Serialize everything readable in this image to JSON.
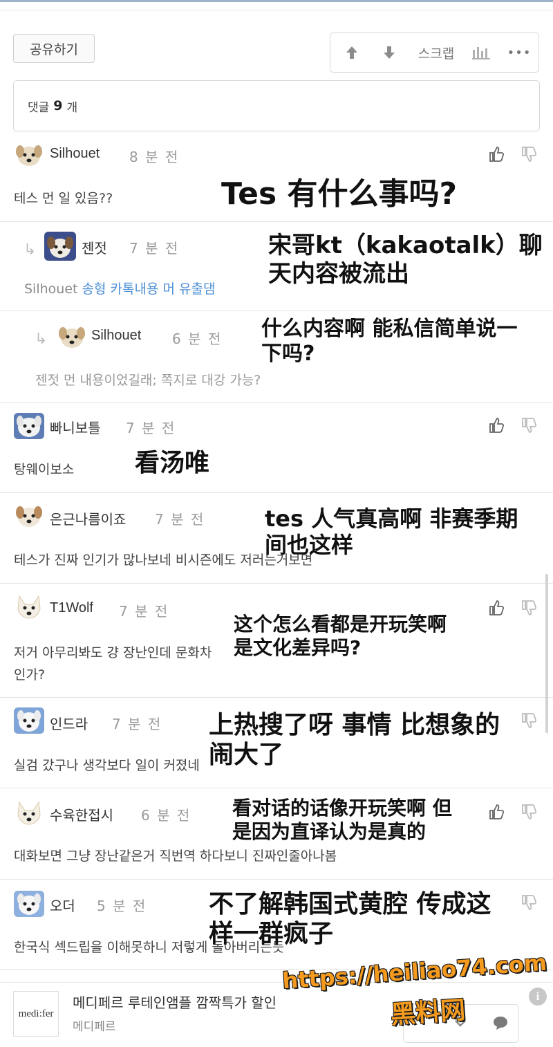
{
  "toolbar": {
    "share_label": "공유하기",
    "scrap_label": "스크랩",
    "more_label": "•••"
  },
  "comment_count": {
    "prefix": "댓글",
    "count": "9",
    "suffix": "개"
  },
  "comments": [
    {
      "author": "Silhouet",
      "time": "8 분 전",
      "text": "테스 먼 일 있음??",
      "overlay": "Tes 有什么事吗?"
    },
    {
      "author": "젠젓",
      "time": "7 분 전",
      "mention": "Silhouet",
      "text": "송형 카톡내용 머 유출댐",
      "overlay": "宋哥kt（kakaotalk）聊天内容被流出"
    },
    {
      "author": "Silhouet",
      "time": "6 분 전",
      "mention": "젠젓",
      "text": "먼 내용이었길래; 쪽지로 대강 가능?",
      "overlay": "什么内容啊 能私信简单说一下吗?"
    },
    {
      "author": "빠니보틀",
      "time": "7 분 전",
      "text": "탕웨이보소",
      "overlay": "看汤唯"
    },
    {
      "author": "은근나름이죠",
      "time": "7 분 전",
      "text": "테스가 진짜 인기가 많나보네 비시즌에도 저러는거보면",
      "overlay": "tes 人气真高啊 非赛季期间也这样"
    },
    {
      "author": "T1Wolf",
      "time": "7 분 전",
      "text": "저거 아무리봐도 걍 장난인데 문화차인가?",
      "overlay": "这个怎么看都是开玩笑啊 是文化差异吗?"
    },
    {
      "author": "인드라",
      "time": "7 분 전",
      "text": "실검 갔구나 생각보다 일이 커졌네",
      "overlay": "上热搜了呀 事情 比想象的闹大了"
    },
    {
      "author": "수육한접시",
      "time": "6 분 전",
      "text": "대화보면 그냥 장난같은거 직번역 하다보니 진짜인줄아나봄",
      "overlay": "看对话的话像开玩笑啊 但是因为直译认为是真的"
    },
    {
      "author": "오더",
      "time": "5 분 전",
      "text": "한국식 섹드립을 이해못하니 저렇게 돌아버리는듯",
      "overlay": "不了解韩国式黄腔 传成这样一群疯子"
    }
  ],
  "ad": {
    "logo": "medi:fer",
    "title": "메디페르 루테인앰플 깜짝특가 할인",
    "subtitle": "메디페르",
    "info": "i"
  },
  "watermark": {
    "url": "https://heiliao74.com",
    "name": "黑料网"
  },
  "colors": {
    "accent": "#4d8fd6",
    "watermark": "#f39a1f",
    "border": "#d8d8d8"
  }
}
